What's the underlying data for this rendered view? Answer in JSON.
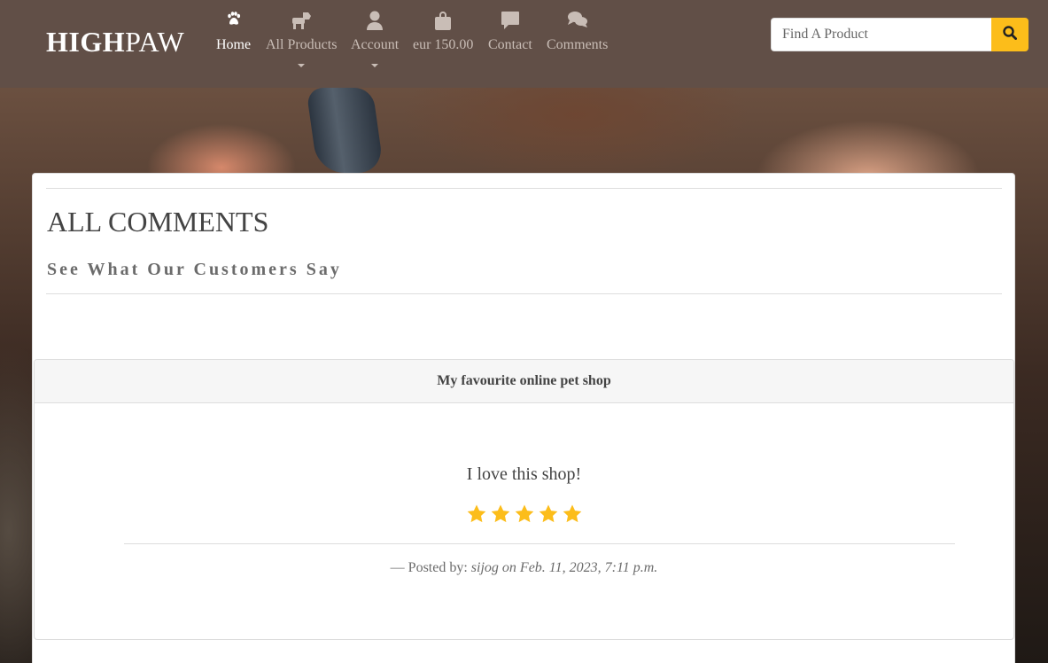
{
  "brand": {
    "bold": "HIGH",
    "light": "PAW"
  },
  "nav": {
    "home": {
      "label": "Home",
      "icon": "paw-icon"
    },
    "products": {
      "label": "All Products",
      "icon": "dog-icon"
    },
    "account": {
      "label": "Account",
      "icon": "user-icon"
    },
    "bag": {
      "label": "eur 150.00",
      "icon": "shopping-bag-icon"
    },
    "contact": {
      "label": "Contact",
      "icon": "comment-icon"
    },
    "comments": {
      "label": "Comments",
      "icon": "comments-icon"
    }
  },
  "search": {
    "placeholder": "Find A Product",
    "value": ""
  },
  "page": {
    "title": "ALL COMMENTS",
    "subtitle": "See What Our Customers Say"
  },
  "comment": {
    "title": "My favourite online pet shop",
    "text": "I love this shop!",
    "rating": 5,
    "posted_prefix": "— Posted by:",
    "author": "sijog",
    "date": "on Feb. 11, 2023, 7:11 p.m."
  },
  "colors": {
    "navbar": "#614f47",
    "accent": "#fcbd1a",
    "star": "#fcbd1a"
  }
}
